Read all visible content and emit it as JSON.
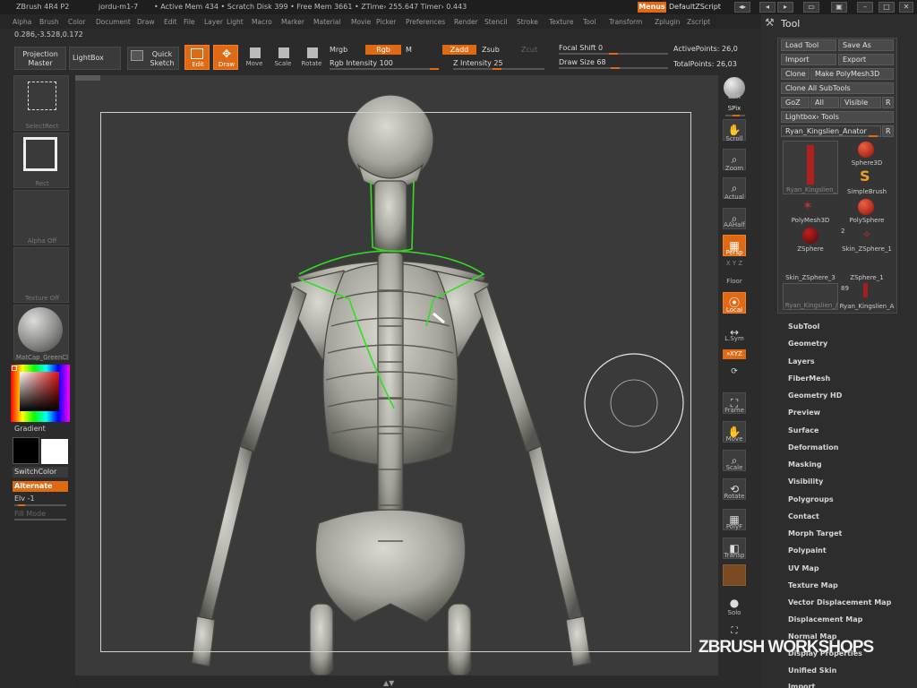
{
  "titlebar": {
    "app": "ZBrush 4R4 P2",
    "doc": "jordu-m1-7",
    "mem": "• Active Mem 434 • Scratch Disk 399 • Free Mem 3661 • ZTime› 255.647  Timer› 0.443",
    "menus": "Menus",
    "script": "DefaultZScript"
  },
  "menubar": [
    "Alpha",
    "Brush",
    "Color",
    "Document",
    "Draw",
    "Edit",
    "File",
    "Layer",
    "Light",
    "Macro",
    "Marker",
    "Material",
    "Movie",
    "Picker",
    "Preferences",
    "Render",
    "Stencil",
    "Stroke",
    "Texture",
    "Tool",
    "Transform",
    "Zplugin",
    "Zscript"
  ],
  "coords": "0.286,-3.528,0.172",
  "shelf": {
    "projection_master": "Projection Master",
    "lightbox": "LightBox",
    "quick_sketch": "Quick Sketch",
    "edit": "Edit",
    "draw": "Draw",
    "move": "Move",
    "scale": "Scale",
    "rotate": "Rotate",
    "mrgb": "Mrgb",
    "rgb": "Rgb",
    "m": "M",
    "rgb_intensity": "Rgb Intensity 100",
    "zadd": "Zadd",
    "zsub": "Zsub",
    "zcut": "Zcut",
    "z_intensity": "Z Intensity 25",
    "focal_shift": "Focal Shift 0",
    "draw_size": "Draw Size 68",
    "active_points": "ActivePoints: 26,0",
    "total_points": "TotalPoints: 26,03"
  },
  "left": {
    "select_rect": "SelectRect",
    "rect": "Rect",
    "alpha_off": "Alpha Off",
    "texture_off": "Texture Off",
    "matcap": "MatCap_GreenCl",
    "gradient": "Gradient",
    "switch_color": "SwitchColor",
    "alternate": "Alternate",
    "elv": "Elv -1",
    "fill_mode": "Fill Mode"
  },
  "right": {
    "bpr": "BPR",
    "spix": "SPix",
    "scroll": "Scroll",
    "zoom": "Zoom",
    "actual": "Actual",
    "aahalf": "AAHalf",
    "persp": "Persp",
    "floor": "Floor",
    "local": "Local",
    "lsym": "L.Sym",
    "xyz": "»XYZ",
    "frame": "Frame",
    "move": "Move",
    "scale": "Scale",
    "rotate": "Rotate",
    "polyf": "PolyF",
    "transp": "Transp",
    "solo": "Solo",
    "xyz_label": "X Y Z"
  },
  "tool": {
    "title": "Tool",
    "load_tool": "Load Tool",
    "save_as": "Save As",
    "import": "Import",
    "export": "Export",
    "clone": "Clone",
    "make_polymesh": "Make PolyMesh3D",
    "clone_all": "Clone All SubTools",
    "goz": "GoZ",
    "all": "All",
    "visible": "Visible",
    "r": "R",
    "lightbox_tools": "Lightbox› Tools",
    "current": "Ryan_Kingslien_Anator",
    "r2": "R",
    "thumbs": [
      "Ryan_Kingslien_",
      "Sphere3D",
      "SimpleBrush",
      "PolyMesh3D",
      "PolySphere",
      "ZSphere",
      "Skin_ZSphere_1",
      "Skin_ZSphere_3",
      "ZSphere_1",
      "Ryan_Kingslien_/",
      "Ryan_Kingslien_A"
    ],
    "count_a": "2",
    "count_b": "89"
  },
  "subpalettes": [
    "SubTool",
    "Geometry",
    "Layers",
    "FiberMesh",
    "Geometry HD",
    "Preview",
    "Surface",
    "Deformation",
    "Masking",
    "Visibility",
    "Polygroups",
    "Contact",
    "Morph Target",
    "Polypaint",
    "UV Map",
    "Texture Map",
    "Vector Displacement Map",
    "Displacement Map",
    "Normal Map",
    "Display Properties",
    "Unified Skin",
    "Import"
  ],
  "watermark": "ZBRUSH WORKSHOPS",
  "colors": {
    "accent": "#e06a14",
    "bg": "#2b2b2b",
    "canvas": "#3a3a3a"
  }
}
